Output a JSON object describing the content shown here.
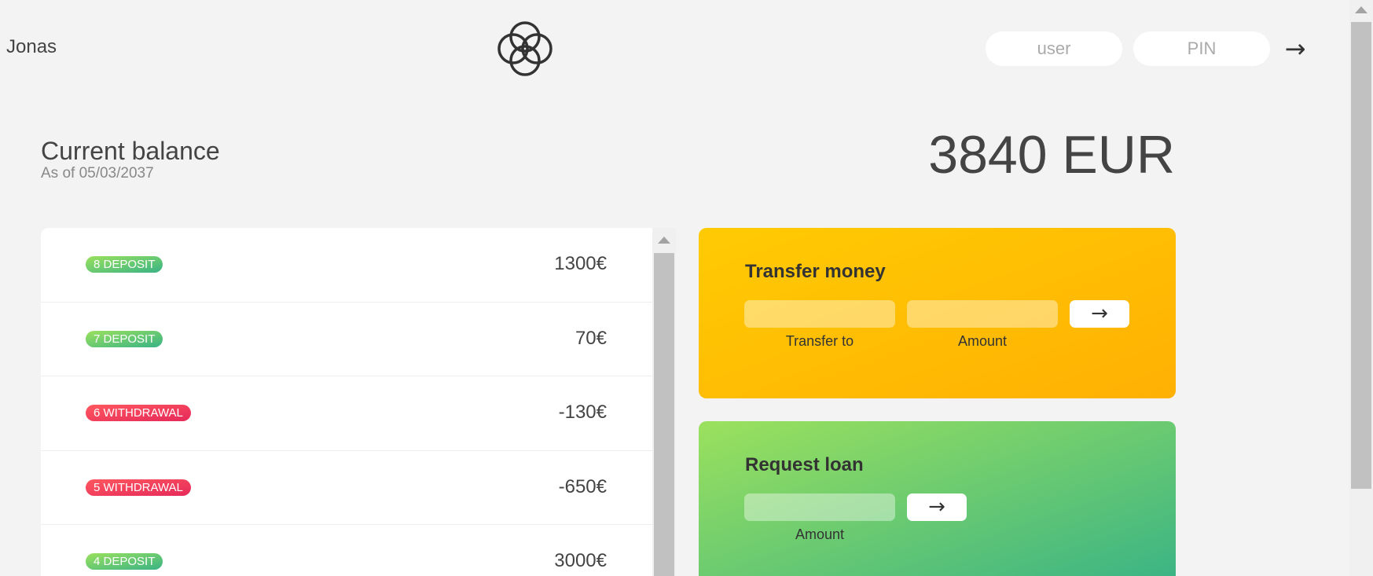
{
  "header": {
    "welcome": "Jonas",
    "user_placeholder": "user",
    "pin_placeholder": "PIN",
    "login_arrow": "→"
  },
  "balance": {
    "label": "Current balance",
    "date": "As of 05/03/2037",
    "value": "3840 EUR"
  },
  "movements": [
    {
      "type_label": "8 DEPOSIT",
      "kind": "deposit",
      "value": "1300€"
    },
    {
      "type_label": "7 DEPOSIT",
      "kind": "deposit",
      "value": "70€"
    },
    {
      "type_label": "6 WITHDRAWAL",
      "kind": "withdrawal",
      "value": "-130€"
    },
    {
      "type_label": "5 WITHDRAWAL",
      "kind": "withdrawal",
      "value": "-650€"
    },
    {
      "type_label": "4 DEPOSIT",
      "kind": "deposit",
      "value": "3000€"
    }
  ],
  "transfer": {
    "title": "Transfer money",
    "to_label": "Transfer to",
    "amount_label": "Amount",
    "button": "→"
  },
  "loan": {
    "title": "Request loan",
    "amount_label": "Amount",
    "button": "→"
  },
  "colors": {
    "deposit": "#39b385",
    "withdrawal": "#e52a5a",
    "transfer_bg": "#ffb003",
    "loan_bg": "#9be15d"
  }
}
